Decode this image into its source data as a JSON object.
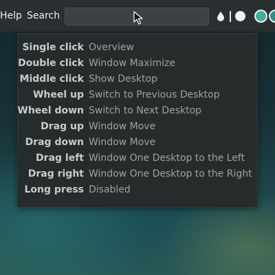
{
  "topbar": {
    "help_label": "Help",
    "search_label": "Search",
    "search_value": "",
    "icons": [
      "drop-icon",
      "circle-white-icon",
      "circle-teal-icon",
      "circle-teal-icon"
    ]
  },
  "popup": {
    "rows": [
      {
        "action": "Single click",
        "effect": "Overview"
      },
      {
        "action": "Double click",
        "effect": "Window Maximize"
      },
      {
        "action": "Middle click",
        "effect": "Show Desktop"
      },
      {
        "action": "Wheel up",
        "effect": "Switch to Previous Desktop"
      },
      {
        "action": "Wheel down",
        "effect": "Switch to Next Desktop"
      },
      {
        "action": "Drag up",
        "effect": "Window Move"
      },
      {
        "action": "Drag down",
        "effect": "Window Move"
      },
      {
        "action": "Drag left",
        "effect": "Window One Desktop to the Left"
      },
      {
        "action": "Drag right",
        "effect": "Window One Desktop to the Right"
      },
      {
        "action": "Long press",
        "effect": "Disabled"
      }
    ]
  },
  "colors": {
    "topbar_bg": "#2a2f31",
    "popup_bg": "#262c2c",
    "action_text": "#c8cccd",
    "effect_text": "#9ea3a4",
    "accent_teal": "#3fae9f"
  }
}
